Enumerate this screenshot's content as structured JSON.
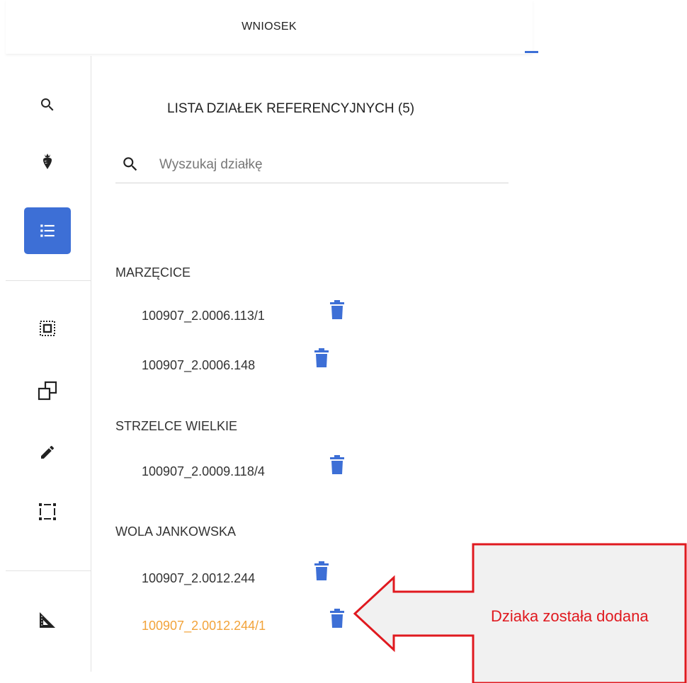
{
  "header": {
    "tab_label": "WNIOSEK"
  },
  "toolbar": {
    "items": [
      {
        "icon": "search-icon"
      },
      {
        "icon": "beet-icon"
      },
      {
        "icon": "list-icon",
        "active": true
      },
      {
        "icon": "select-area-icon"
      },
      {
        "icon": "copy-shape-icon"
      },
      {
        "icon": "pencil-icon"
      },
      {
        "icon": "dashed-rectangle-icon"
      },
      {
        "icon": "set-square-icon"
      }
    ],
    "accent_color": "#3d6fd6"
  },
  "panel": {
    "title": "LISTA DZIAŁEK REFERENCYJNYCH (5)",
    "search": {
      "placeholder": "Wyszukaj działkę",
      "value": ""
    },
    "groups": [
      {
        "name": "MARZĘCICE",
        "parcels": [
          {
            "id": "100907_2.0006.113/1"
          },
          {
            "id": "100907_2.0006.148"
          }
        ]
      },
      {
        "name": "STRZELCE WIELKIE",
        "parcels": [
          {
            "id": "100907_2.0009.118/4"
          }
        ]
      },
      {
        "name": "WOLA JANKOWSKA",
        "parcels": [
          {
            "id": "100907_2.0012.244"
          },
          {
            "id": "100907_2.0012.244/1",
            "highlight_color": "#f2a33a"
          }
        ]
      }
    ]
  },
  "callout": {
    "text": "Dziaka została dodana",
    "color": "#e0191f"
  }
}
